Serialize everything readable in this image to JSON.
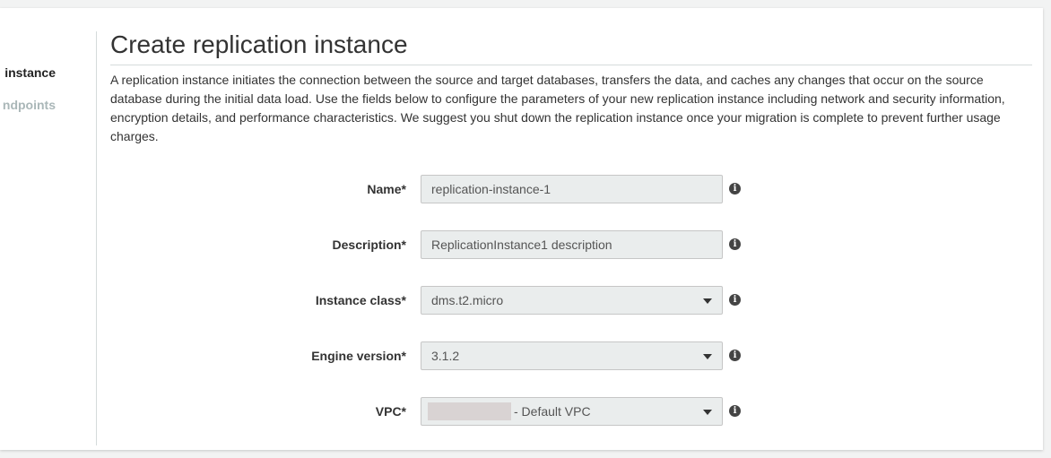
{
  "wizard": {
    "steps": [
      {
        "label": "instance"
      },
      {
        "label": "ndpoints"
      }
    ]
  },
  "page": {
    "title": "Create replication instance",
    "description": "A replication instance initiates the connection between the source and target databases, transfers the data, and caches any changes that occur on the source database during the initial data load. Use the fields below to configure the parameters of your new replication instance including network and security information, encryption details, and performance characteristics. We suggest you shut down the replication instance once your migration is complete to prevent further usage charges."
  },
  "form": {
    "name": {
      "label": "Name*",
      "value": "replication-instance-1"
    },
    "description": {
      "label": "Description*",
      "value": "ReplicationInstance1 description"
    },
    "instance_class": {
      "label": "Instance class*",
      "value": "dms.t2.micro"
    },
    "engine_version": {
      "label": "Engine version*",
      "value": "3.1.2"
    },
    "vpc": {
      "label": "VPC*",
      "value": "- Default VPC"
    }
  },
  "icons": {
    "info": "info-icon",
    "dropdown": "chevron-down-icon"
  },
  "colors": {
    "background": "#f2f3f3",
    "card": "#ffffff",
    "field_background": "#eaeded",
    "muted_text": "#aab7b8"
  }
}
